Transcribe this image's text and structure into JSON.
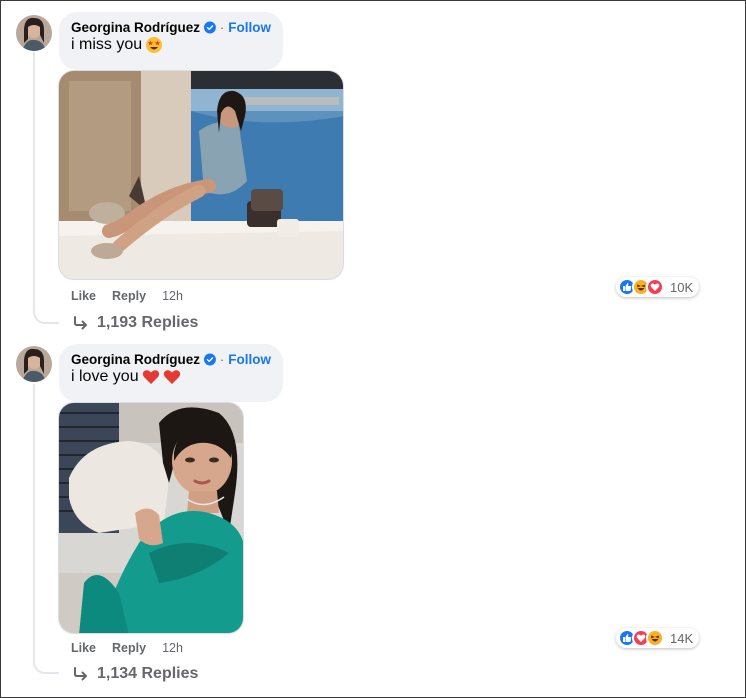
{
  "comments": [
    {
      "author": "Georgina Rodríguez",
      "separator": "·",
      "follow_label": "Follow",
      "text": "i miss you",
      "emojis": [
        "star-struck"
      ],
      "actions": {
        "like": "Like",
        "reply": "Reply",
        "time": "12h"
      },
      "reaction_icons": [
        "like-reaction",
        "haha-reaction",
        "love-reaction"
      ],
      "reaction_count": "10K",
      "replies_label": "1,193 Replies"
    },
    {
      "author": "Georgina Rodríguez",
      "separator": "·",
      "follow_label": "Follow",
      "text": "i love you",
      "emojis": [
        "red-heart",
        "red-heart"
      ],
      "actions": {
        "like": "Like",
        "reply": "Reply",
        "time": "12h"
      },
      "reaction_icons": [
        "like-reaction",
        "love-reaction",
        "haha-reaction"
      ],
      "reaction_count": "14K",
      "replies_label": "1,134 Replies"
    }
  ],
  "colors": {
    "follow": "#1877f2",
    "like": "#1877f2",
    "love": "#f33e58",
    "haha": "#f7b125",
    "muted": "#65676b",
    "bubble": "#f0f2f5"
  }
}
